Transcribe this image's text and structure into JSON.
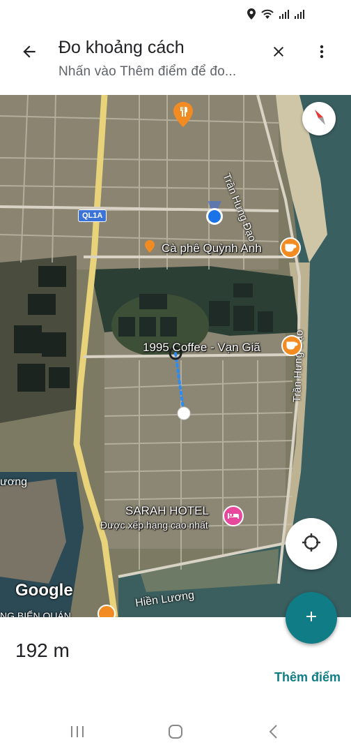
{
  "status_bar": {
    "icons": [
      "location-icon",
      "wifi-icon",
      "signal-icon",
      "signal-icon"
    ]
  },
  "app_bar": {
    "title": "Đo khoảng cách",
    "subtitle": "Nhấn vào Thêm điểm để đo..."
  },
  "map": {
    "pois": [
      {
        "name": "Cà phê Quỳnh Anh",
        "type": "cafe"
      },
      {
        "name": "1995 Coffee - Vạn Giã",
        "type": "cafe"
      },
      {
        "name": "SARAH HOTEL",
        "sub": "Được xếp hạng cao nhất",
        "type": "hotel"
      }
    ],
    "roads": {
      "tran_hung_dao_1": "Trần Hưng Đạo",
      "tran_hung_dao_2": "Trần Hưng Đạo",
      "highway": "QL1A",
      "area_1": "Hiền Lương",
      "area_2": "ương",
      "area_3": "NG BIỂN QUÁN"
    },
    "logo": "Google",
    "colors": {
      "measure_line": "#2d8cf0",
      "location_dot": "#1a73e8",
      "cafe_pin": "#f28b22",
      "hotel_pin": "#e8489b",
      "restaurant_pin": "#f28b22"
    }
  },
  "measurement": {
    "distance": "192 m",
    "add_point_label": "Thêm điểm"
  },
  "accent_color": "#0f7c86",
  "nav_bar": {
    "buttons": [
      "recents-icon",
      "home-icon",
      "back-icon"
    ]
  }
}
